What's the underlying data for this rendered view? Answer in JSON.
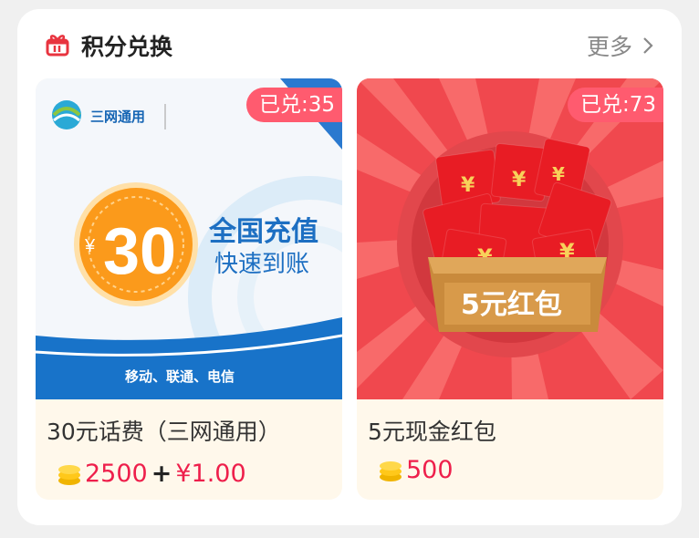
{
  "header": {
    "title": "积分兑换",
    "more": "更多"
  },
  "items": [
    {
      "name": "30元话费（三网通用）",
      "badge": "已兑:35",
      "points": "2500",
      "plus": "+",
      "cash": "¥1.00",
      "art": {
        "brand": "三网通用",
        "amount": "30",
        "currency": "¥",
        "headline": "全国充值",
        "subline": "快速到账",
        "carriers": "移动、联通、电信"
      }
    },
    {
      "name": "5元现金红包",
      "badge": "已兑:73",
      "points": "500",
      "art": {
        "label": "5元红包"
      }
    }
  ],
  "colors": {
    "accent": "#ee1f4b",
    "badge": "#ff5b6f",
    "card_bottom": "#fff8eb"
  }
}
